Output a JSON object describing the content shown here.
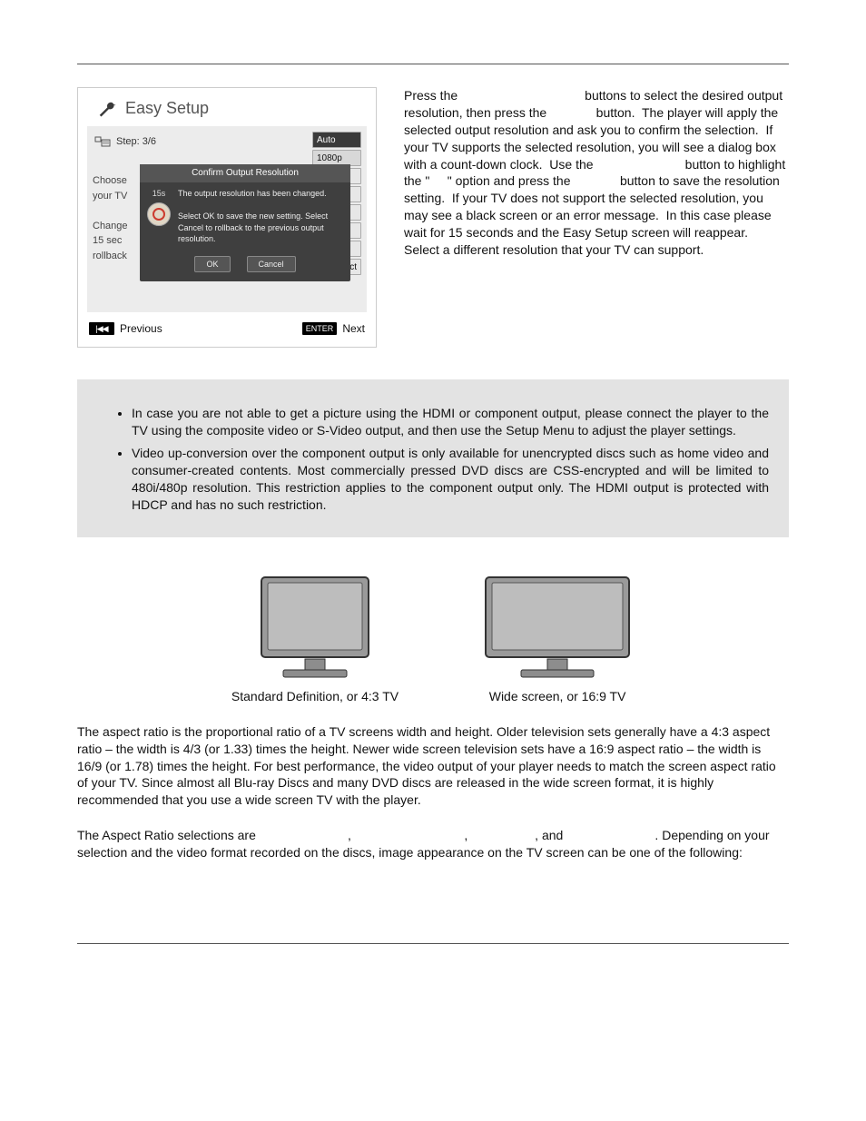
{
  "easy_setup": {
    "title": "Easy Setup",
    "step_label": "Step: 3/6",
    "bg_lines": [
      "Choose",
      "your TV",
      "",
      "Change",
      "15 sec",
      "rollback"
    ],
    "options": {
      "auto": "Auto",
      "r1080p": "1080p"
    },
    "trailing_ct": "ct",
    "dialog": {
      "title": "Confirm Output Resolution",
      "timer": "15s",
      "line1": "The output resolution has been changed.",
      "line2": "Select OK to save the new setting. Select Cancel to rollback to the previous output resolution.",
      "ok": "OK",
      "cancel": "Cancel"
    },
    "nav": {
      "previous": "Previous",
      "enter_key": "ENTER",
      "next": "Next"
    }
  },
  "right_para": "Press the                                    buttons to select the desired output resolution, then press the              button.  The player will apply the selected output resolution and ask you to confirm the selection.  If your TV supports the selected resolution, you will see a dialog box with a count-down clock.  Use the                          button to highlight the \"     \" option and press the              button to save the resolution setting.  If your TV does not support the selected resolution, you may see a black screen or an error message.  In this case please wait for 15 seconds and the Easy Setup screen will reappear.  Select a different resolution that your TV can support.",
  "notes": [
    "In case you are not able to get a picture using the HDMI or component output, please connect the player to the TV using the composite video or S-Video output, and then use the Setup Menu to adjust the player settings.",
    "Video up-conversion over the component output is only available for unencrypted discs such as home video and consumer-created contents.  Most commercially pressed DVD discs are CSS-encrypted and will be limited to 480i/480p resolution. This restriction applies to the component output only.  The HDMI output is protected with HDCP and has no such restriction."
  ],
  "tv_captions": {
    "sd": "Standard Definition, or 4:3 TV",
    "wide": "Wide screen, or 16:9 TV"
  },
  "aspect_para1": "The aspect ratio is the proportional ratio of a TV screens width and height.  Older television sets generally have a 4:3 aspect ratio – the width is 4/3 (or 1.33) times the height.  Newer wide screen television sets have a 16:9 aspect ratio – the width is 16/9 (or 1.78) times the height.  For best performance, the video output of your player needs to match the screen aspect ratio of your TV.  Since almost all Blu-ray Discs and many DVD discs are released in the wide screen format, it is highly recommended that you use a wide screen TV with the player.",
  "aspect_para2": "The Aspect Ratio selections are                          ,                                ,                   , and                          . Depending on your selection and the video format recorded on the discs, image appearance on the TV screen can be one of the following:"
}
